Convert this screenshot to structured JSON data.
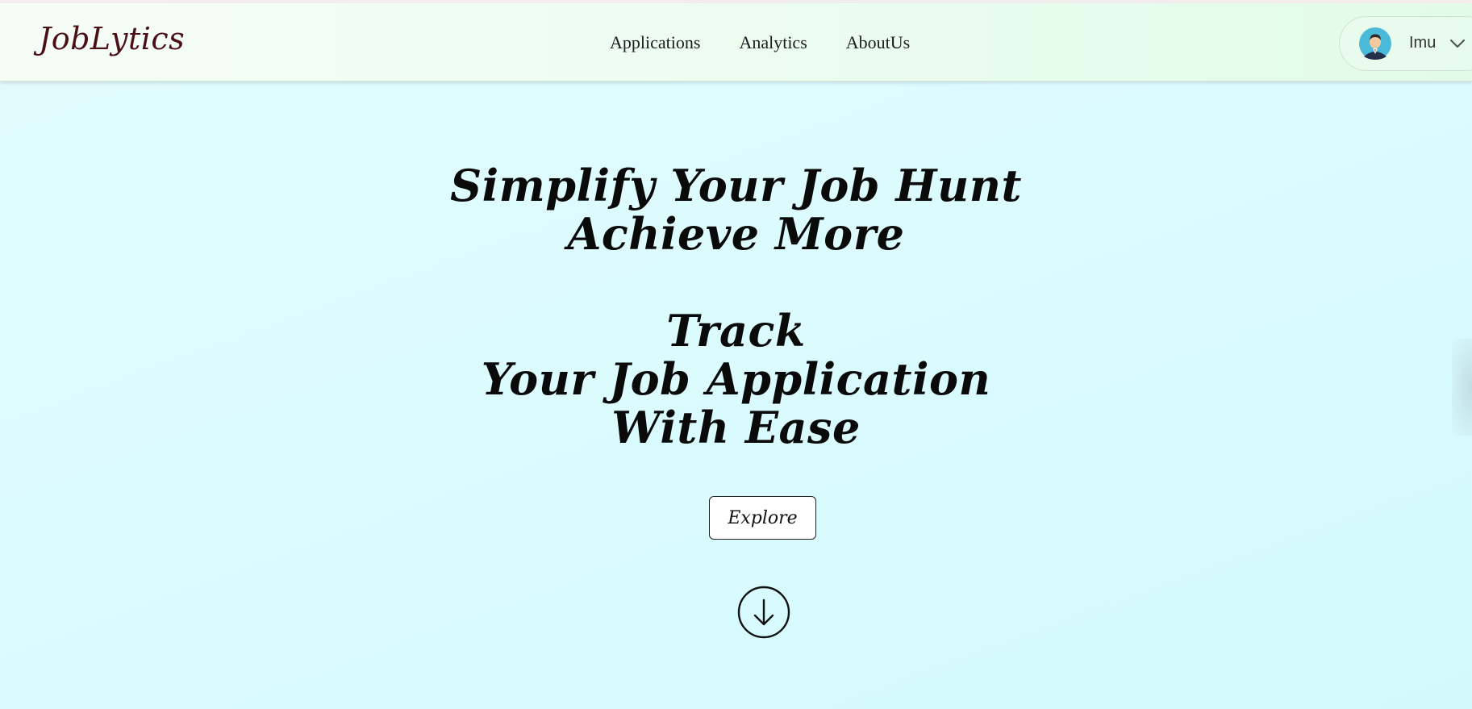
{
  "brand": {
    "logo_text": "JobLytics"
  },
  "nav": {
    "links": [
      {
        "label": "Applications"
      },
      {
        "label": "Analytics"
      },
      {
        "label": "AboutUs"
      }
    ]
  },
  "user": {
    "name": "Imu",
    "avatar_icon": "user-avatar-icon",
    "menu_icon": "chevron-down-icon"
  },
  "hero": {
    "headline_lines": [
      "Simplify Your Job Hunt",
      "Achieve More"
    ],
    "tagline_lines": [
      "Track",
      "Your Job Application",
      "With Ease"
    ],
    "cta_label": "Explore",
    "scroll_icon": "arrow-down-circle-icon"
  },
  "colors": {
    "logo": "#4a1016",
    "background": "#dcfbfd",
    "navbar": "#ecfdf0",
    "text": "#0a0a0a"
  }
}
